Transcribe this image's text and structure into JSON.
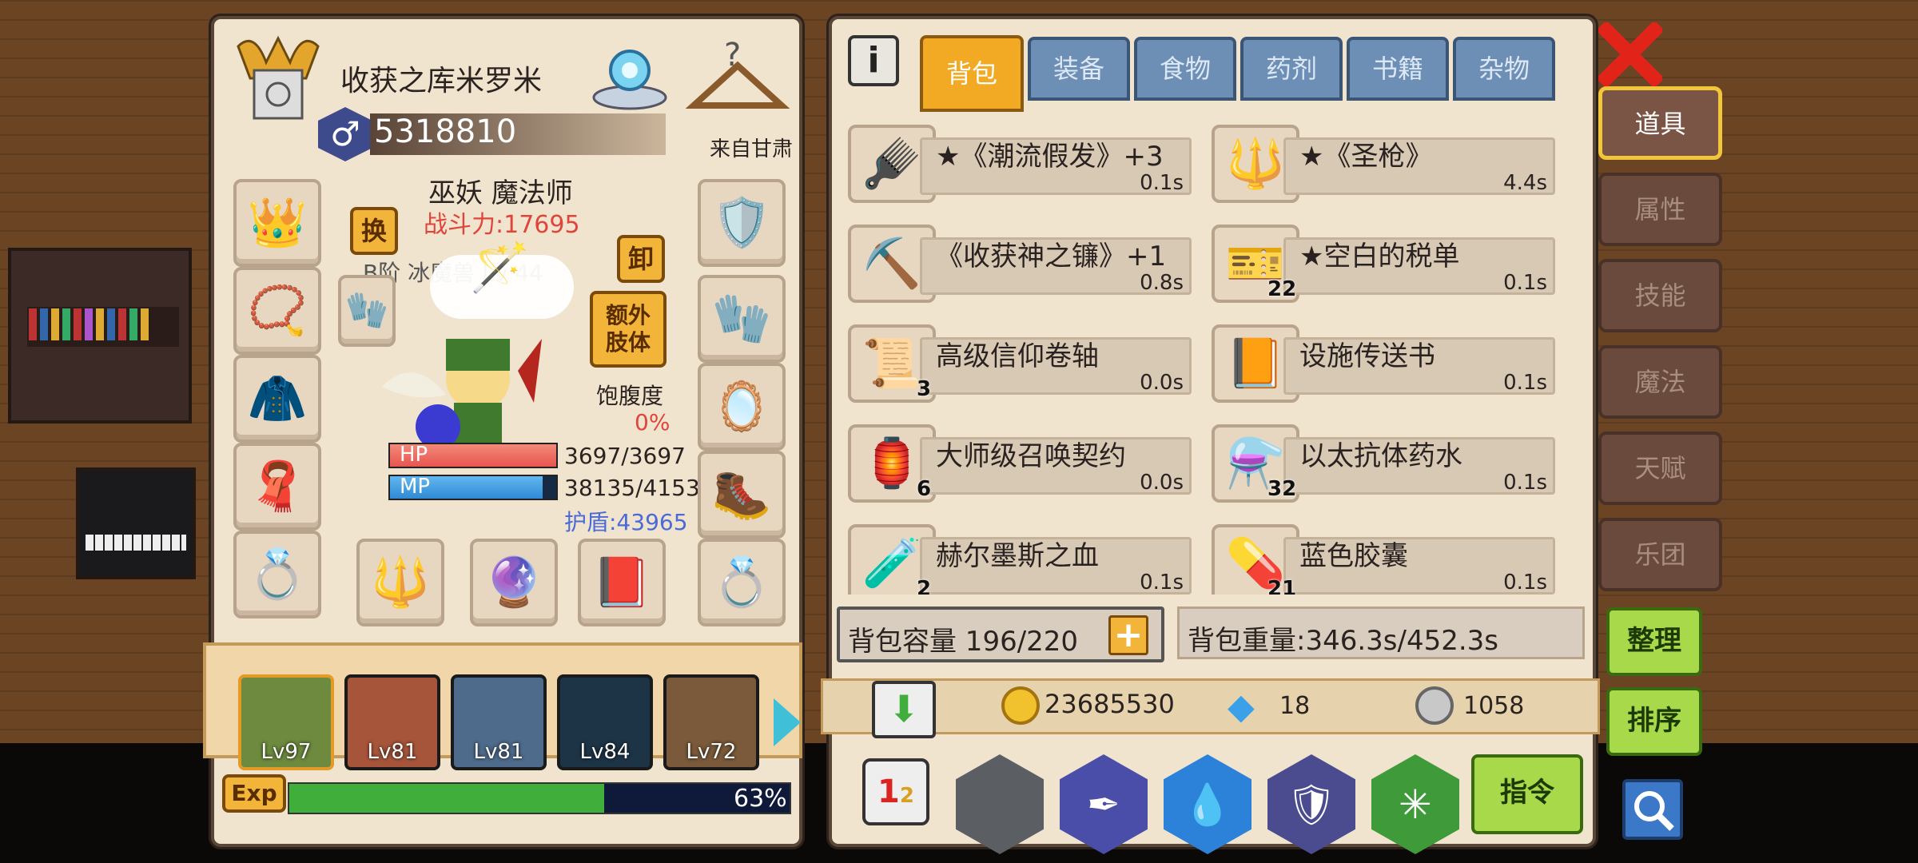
{
  "character": {
    "name": "收获之库米罗米",
    "id_number": "5318810",
    "origin": "来自甘肃",
    "race_class": "巫妖 魔法师",
    "power": "战斗力:17695",
    "swap_label": "换",
    "unequip_label": "卸",
    "extra_limb_label": "额外\n肢体",
    "pet_info": "B阶 冰魔兽 Lv 44",
    "satiety_label": "饱腹度",
    "satiety_value": "0%",
    "hp_label": "HP",
    "hp_value": "3697/3697",
    "hp_fraction": 1.0,
    "mp_label": "MP",
    "mp_value": "38135/41539",
    "mp_fraction": 0.918,
    "shield": "护盾:43965"
  },
  "party": [
    {
      "level": "Lv97"
    },
    {
      "level": "Lv81"
    },
    {
      "level": "Lv81"
    },
    {
      "level": "Lv84"
    },
    {
      "level": "Lv72"
    }
  ],
  "exp": {
    "label": "Exp",
    "percent_text": "63%",
    "fraction": 0.63
  },
  "tabs": [
    "背包",
    "装备",
    "食物",
    "药剂",
    "书籍",
    "杂物"
  ],
  "side_tabs": [
    "道具",
    "属性",
    "技能",
    "魔法",
    "天赋",
    "乐团"
  ],
  "items": [
    {
      "name": "★《潮流假发》+3",
      "weight": "0.1s",
      "count": "",
      "icon": "wig-icon"
    },
    {
      "name": "★《圣枪》",
      "weight": "4.4s",
      "count": "",
      "icon": "spear-icon"
    },
    {
      "name": "《收获神之镰》+1",
      "weight": "0.8s",
      "count": "",
      "icon": "scythe-icon"
    },
    {
      "name": "★空白的税单",
      "weight": "0.1s",
      "count": "22",
      "icon": "tax-form-icon"
    },
    {
      "name": "高级信仰卷轴",
      "weight": "0.0s",
      "count": "3",
      "icon": "scroll-icon"
    },
    {
      "name": "设施传送书",
      "weight": "0.1s",
      "count": "",
      "icon": "book-icon"
    },
    {
      "name": "大师级召唤契约",
      "weight": "0.0s",
      "count": "6",
      "icon": "contract-icon"
    },
    {
      "name": "以太抗体药水",
      "weight": "0.1s",
      "count": "32",
      "icon": "potion-icon"
    },
    {
      "name": "赫尔墨斯之血",
      "weight": "0.1s",
      "count": "2",
      "icon": "blood-icon"
    },
    {
      "name": "蓝色胶囊",
      "weight": "0.1s",
      "count": "21",
      "icon": "capsule-icon"
    }
  ],
  "capacity": "背包容量 196/220",
  "weight": "背包重量:346.3s/452.3s",
  "currency": {
    "gold": "23685530",
    "diamond": "18",
    "silver": "1058"
  },
  "buttons": {
    "sort_organize": "整理",
    "sort_order": "排序",
    "command": "指令"
  },
  "colors": {
    "accent": "#f2a923",
    "tab_blue": "#6e8fb5",
    "hp_red": "#e8554f",
    "mp_blue": "#2f8ad4",
    "exp_green": "#3fae3a"
  }
}
